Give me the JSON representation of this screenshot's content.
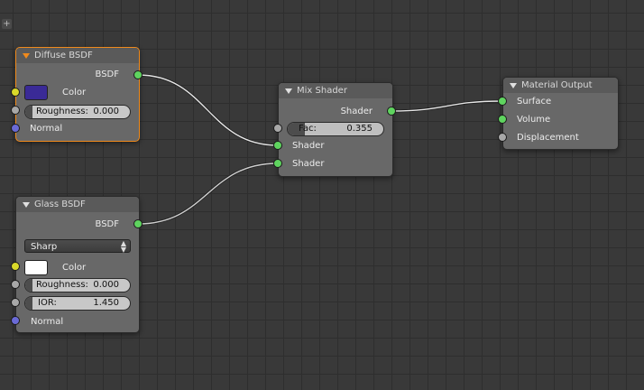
{
  "nodes": {
    "diffuse": {
      "title": "Diffuse BSDF",
      "output": "BSDF",
      "color_label": "Color",
      "color_value": "#3a2a96",
      "roughness_label": "Roughness:",
      "roughness_value": "0.000",
      "normal_label": "Normal"
    },
    "glass": {
      "title": "Glass BSDF",
      "output": "BSDF",
      "distribution": "Sharp",
      "color_label": "Color",
      "color_value": "#ffffff",
      "roughness_label": "Roughness:",
      "roughness_value": "0.000",
      "ior_label": "IOR:",
      "ior_value": "1.450",
      "normal_label": "Normal"
    },
    "mix": {
      "title": "Mix Shader",
      "output": "Shader",
      "fac_label": "Fac:",
      "fac_value": "0.355",
      "fac_fraction": 0.355,
      "input1": "Shader",
      "input2": "Shader"
    },
    "output": {
      "title": "Material Output",
      "surface": "Surface",
      "volume": "Volume",
      "displacement": "Displacement"
    }
  },
  "colors": {
    "socket_shader": "#5fd45f",
    "socket_color": "#d9d92a",
    "socket_value": "#a8a8a8",
    "socket_vector": "#6a6ad6",
    "active_outline": "#f08a1c"
  },
  "links": [
    {
      "from": "diffuse.BSDF",
      "to": "mix.Shader1"
    },
    {
      "from": "glass.BSDF",
      "to": "mix.Shader2"
    },
    {
      "from": "mix.Shader",
      "to": "output.Surface"
    }
  ]
}
